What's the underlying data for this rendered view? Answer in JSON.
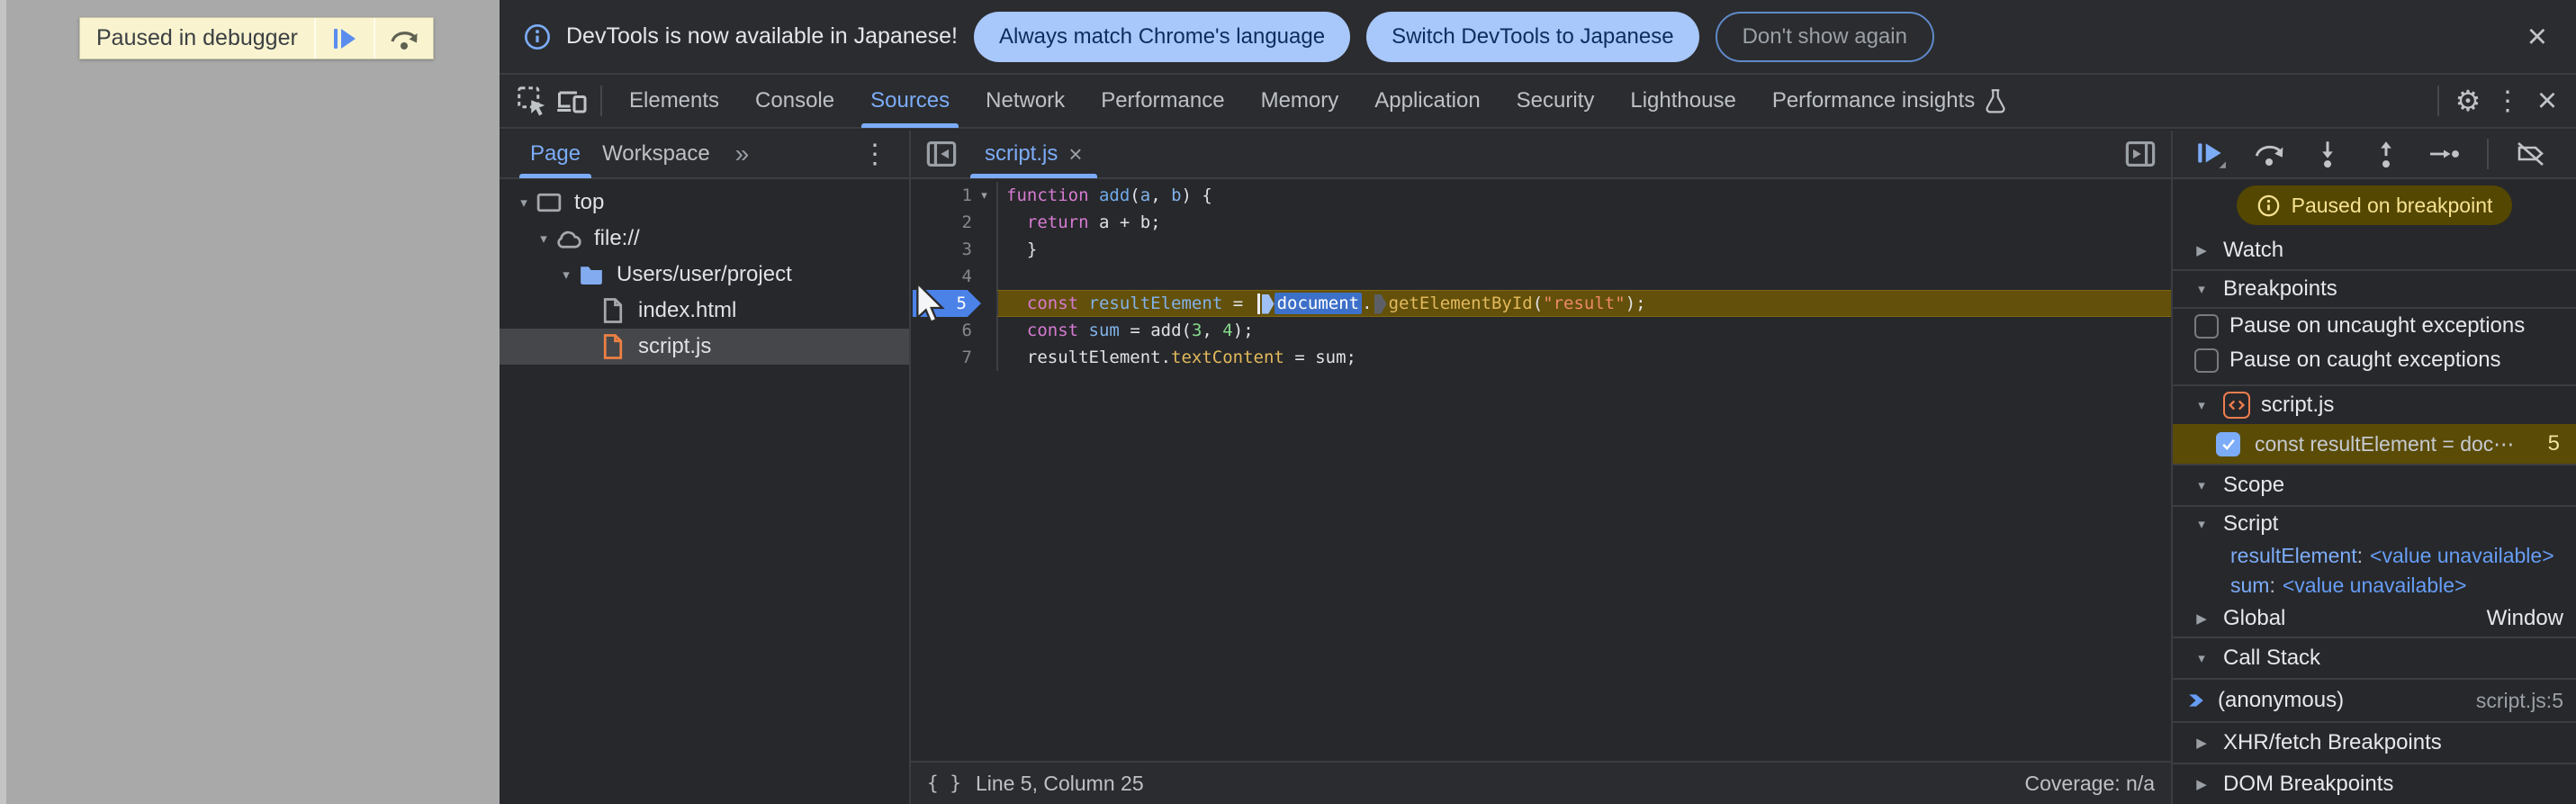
{
  "colors": {
    "accent": "#7cacf8",
    "paused_bg": "#544701",
    "paused_text": "#f6e292",
    "exec_line_bg": "#63500a",
    "bp_flag": "#4b82e8",
    "source_orange": "#ed7d4f"
  },
  "icons": {
    "close": "×",
    "kebab": "⋮",
    "overflow_chevrons": "»",
    "triangle_down": "▾",
    "triangle_right": "▶",
    "triangle_down_big": "▼",
    "braces": "{ }",
    "gear": "⚙"
  },
  "page": {
    "paused_banner_label": "Paused in debugger"
  },
  "notification": {
    "message": "DevTools is now available in Japanese!",
    "primary_action": "Always match Chrome's language",
    "secondary_action": "Switch DevTools to Japanese",
    "dismiss_action": "Don't show again"
  },
  "main_tabs": {
    "items": [
      "Elements",
      "Console",
      "Sources",
      "Network",
      "Performance",
      "Memory",
      "Application",
      "Security",
      "Lighthouse",
      "Performance insights"
    ],
    "active": "Sources"
  },
  "navigator": {
    "tabs": {
      "page": "Page",
      "workspace": "Workspace"
    },
    "tree": [
      {
        "label": "top"
      },
      {
        "label": "file://"
      },
      {
        "label": "Users/user/project"
      },
      {
        "label": "index.html"
      },
      {
        "label": "script.js"
      }
    ]
  },
  "editor": {
    "tab": "script.js",
    "status": {
      "line_col": "Line 5, Column 25",
      "coverage": "Coverage: n/a"
    },
    "code": {
      "lines": [
        {
          "num": "1",
          "fold": true,
          "segments": [
            {
              "t": "function",
              "c": "kw"
            },
            {
              "t": " ",
              "c": "pl"
            },
            {
              "t": "add",
              "c": "fn"
            },
            {
              "t": "(",
              "c": "pl"
            },
            {
              "t": "a",
              "c": "def"
            },
            {
              "t": ", ",
              "c": "pl"
            },
            {
              "t": "b",
              "c": "def"
            },
            {
              "t": ") {",
              "c": "pl"
            }
          ]
        },
        {
          "num": "2",
          "segments": [
            {
              "t": "  ",
              "c": "pl"
            },
            {
              "t": "return",
              "c": "kw"
            },
            {
              "t": " a + b;",
              "c": "pl"
            }
          ]
        },
        {
          "num": "3",
          "segments": [
            {
              "t": "  }",
              "c": "pl"
            }
          ]
        },
        {
          "num": "4",
          "segments": []
        },
        {
          "num": "5",
          "current": true,
          "segments": [
            {
              "t": "  ",
              "c": "pl"
            },
            {
              "t": "const",
              "c": "kw"
            },
            {
              "t": " ",
              "c": "pl"
            },
            {
              "t": "resultElement",
              "c": "def"
            },
            {
              "t": " = ",
              "c": "pl"
            },
            {
              "t": "",
              "c": "caret"
            },
            {
              "t": "",
              "c": "marker-active"
            },
            {
              "t": "document",
              "c": "selected"
            },
            {
              "t": ".",
              "c": "pl"
            },
            {
              "t": "",
              "c": "marker"
            },
            {
              "t": "getElementById",
              "c": "prop"
            },
            {
              "t": "(",
              "c": "pl"
            },
            {
              "t": "\"result\"",
              "c": "str"
            },
            {
              "t": ");",
              "c": "pl"
            }
          ]
        },
        {
          "num": "6",
          "segments": [
            {
              "t": "  ",
              "c": "pl"
            },
            {
              "t": "const",
              "c": "kw"
            },
            {
              "t": " ",
              "c": "pl"
            },
            {
              "t": "sum",
              "c": "def"
            },
            {
              "t": " = add(",
              "c": "pl"
            },
            {
              "t": "3",
              "c": "num"
            },
            {
              "t": ", ",
              "c": "pl"
            },
            {
              "t": "4",
              "c": "num"
            },
            {
              "t": ");",
              "c": "pl"
            }
          ]
        },
        {
          "num": "7",
          "segments": [
            {
              "t": "  resultElement.",
              "c": "pl"
            },
            {
              "t": "textContent",
              "c": "prop"
            },
            {
              "t": " = sum;",
              "c": "pl"
            }
          ]
        }
      ]
    }
  },
  "debugger": {
    "paused_message": "Paused on breakpoint",
    "watch_label": "Watch",
    "breakpoints_label": "Breakpoints",
    "pause_uncaught": "Pause on uncaught exceptions",
    "pause_caught": "Pause on caught exceptions",
    "breakpoint_group": {
      "file": "script.js",
      "entry_text": "const resultElement = doc⋯",
      "entry_line": "5"
    },
    "scope_label": "Scope",
    "script_scope_label": "Script",
    "variables": [
      {
        "name": "resultElement",
        "value": "<value unavailable>"
      },
      {
        "name": "sum",
        "value": "<value unavailable>"
      }
    ],
    "global_label": "Global",
    "global_value": "Window",
    "call_stack_label": "Call Stack",
    "frame": {
      "name": "(anonymous)",
      "location": "script.js:5"
    },
    "xhr_label": "XHR/fetch Breakpoints",
    "dom_label": "DOM Breakpoints"
  }
}
